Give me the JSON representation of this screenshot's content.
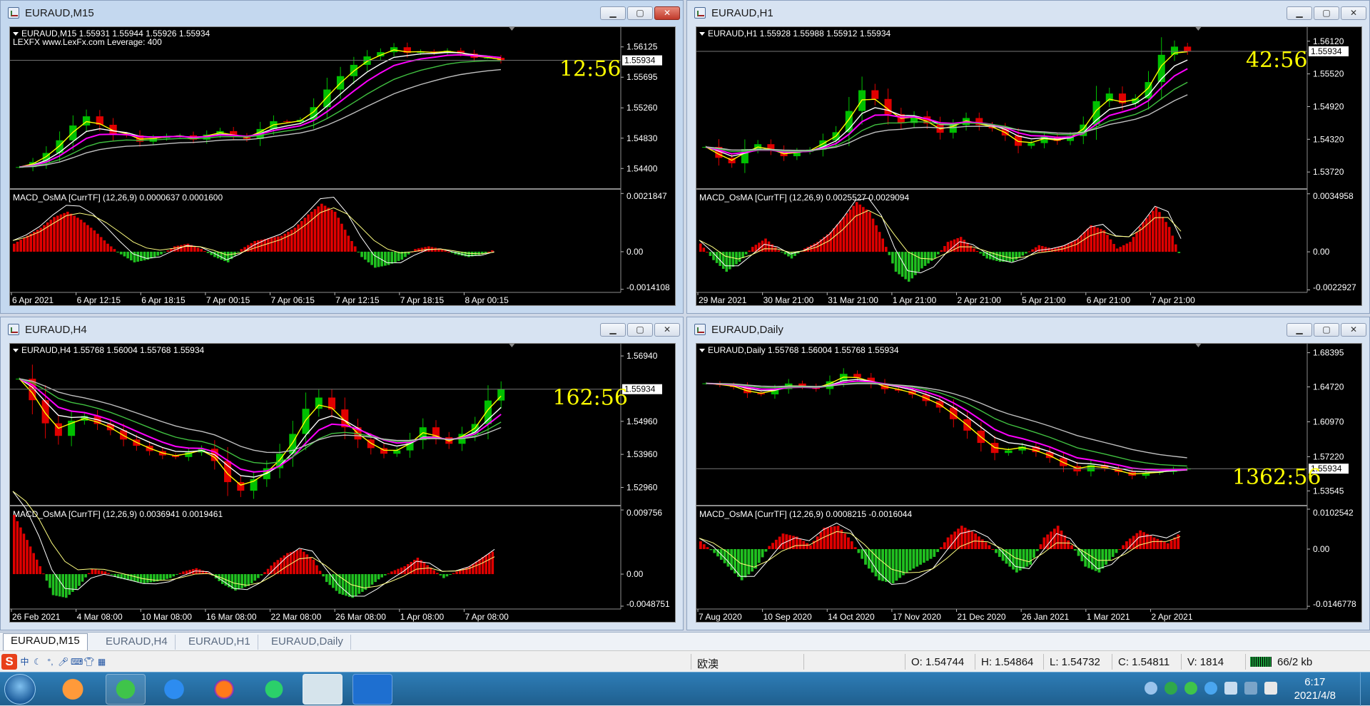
{
  "windows": [
    {
      "title": "EURAUD,M15",
      "active": true,
      "price_info": "EURAUD,M15  1.55931 1.55944 1.55926 1.55934",
      "broker_line": "LEXFX www.LexFx.com Leverage: 400",
      "countdown": "12:56",
      "current_price": "1.55934",
      "price_ticks": [
        "1.56125",
        "1.55695",
        "1.55260",
        "1.54830",
        "1.54400"
      ],
      "macd_label": "MACD_OsMA [CurrTF] (12,26,9) 0.0000637 0.0001600",
      "macd_ticks": [
        "0.0021847",
        "0.00",
        "-0.0014108"
      ],
      "time_labels": [
        "6 Apr 2021",
        "6 Apr 12:15",
        "6 Apr 18:15",
        "7 Apr 00:15",
        "7 Apr 06:15",
        "7 Apr 12:15",
        "7 Apr 18:15",
        "8 Apr 00:15"
      ],
      "price_range": [
        1.5418,
        1.56345
      ],
      "macd_range": [
        -0.0015,
        0.0023
      ],
      "series": {
        "close": [
          1.5442,
          1.5449,
          1.5462,
          1.548,
          1.5501,
          1.5514,
          1.5502,
          1.5489,
          1.5487,
          1.5478,
          1.5483,
          1.5486,
          1.5487,
          1.5481,
          1.5488,
          1.5493,
          1.5486,
          1.5482,
          1.5496,
          1.5507,
          1.5506,
          1.5509,
          1.5527,
          1.5552,
          1.5571,
          1.5587,
          1.5599,
          1.5605,
          1.5612,
          1.5604,
          1.5606,
          1.5604,
          1.5607,
          1.5603,
          1.5597,
          1.5597,
          1.5593
        ],
        "macd": [
          0.0003,
          0.0006,
          0.0009,
          0.0013,
          0.0015,
          0.0012,
          0.0008,
          0.0003,
          -0.0001,
          -0.0004,
          -0.0003,
          -0.0001,
          0.0002,
          0.0003,
          0.0001,
          -0.0002,
          -0.0004,
          0.0001,
          0.0004,
          0.0005,
          0.0006,
          0.0009,
          0.0014,
          0.0018,
          0.0015,
          0.0006,
          -0.0002,
          -0.0006,
          -0.0005,
          -0.0003,
          0.0001,
          0.0002,
          0.0001,
          -0.0001,
          -0.0002,
          -0.0001,
          0.0001
        ]
      }
    },
    {
      "title": "EURAUD,H1",
      "active": false,
      "price_info": "EURAUD,H1  1.55928 1.55988 1.55912 1.55934",
      "broker_line": "",
      "countdown": "42:56",
      "current_price": "1.55934",
      "price_ticks": [
        "1.56120",
        "1.55520",
        "1.54920",
        "1.54320",
        "1.53720"
      ],
      "macd_label": "MACD_OsMA [CurrTF] (12,26,9) 0.0025527 0.0029094",
      "macd_ticks": [
        "0.0034958",
        "0.00",
        "-0.0022927"
      ],
      "time_labels": [
        "29 Mar 2021",
        "30 Mar 21:00",
        "31 Mar 21:00",
        "1 Apr 21:00",
        "2 Apr 21:00",
        "5 Apr 21:00",
        "6 Apr 21:00",
        "7 Apr 21:00"
      ],
      "price_range": [
        1.535,
        1.563
      ],
      "macd_range": [
        -0.0024,
        0.0037
      ],
      "series": {
        "close": [
          1.5418,
          1.5398,
          1.5388,
          1.5414,
          1.5423,
          1.5412,
          1.5401,
          1.5409,
          1.5413,
          1.543,
          1.5445,
          1.5484,
          1.5522,
          1.5506,
          1.5478,
          1.5462,
          1.5474,
          1.5461,
          1.5444,
          1.5458,
          1.5471,
          1.5458,
          1.5452,
          1.5439,
          1.542,
          1.5425,
          1.5437,
          1.5429,
          1.5438,
          1.5459,
          1.5502,
          1.5516,
          1.5498,
          1.5507,
          1.5537,
          1.5587,
          1.5602,
          1.5594
        ],
        "macd": [
          0.0005,
          -0.0005,
          -0.0012,
          -0.0006,
          0.0003,
          0.0008,
          0.0001,
          -0.0004,
          0.0002,
          0.0006,
          0.0012,
          0.0021,
          0.003,
          0.0024,
          0.0008,
          -0.0012,
          -0.0018,
          -0.001,
          -0.0004,
          0.0006,
          0.0009,
          0.0002,
          -0.0004,
          -0.0006,
          -0.0006,
          -0.0001,
          0.0004,
          0.0002,
          0.0004,
          0.0008,
          0.0016,
          0.0013,
          0.0002,
          0.0006,
          0.0018,
          0.0027,
          0.0015,
          -0.0006
        ]
      }
    },
    {
      "title": "EURAUD,H4",
      "active": false,
      "price_info": "EURAUD,H4  1.55768 1.56004 1.55768 1.55934",
      "broker_line": "",
      "countdown": "162:56",
      "current_price": "1.55934",
      "price_ticks": [
        "1.56940",
        "1.55934",
        "1.54960",
        "1.53960",
        "1.52960"
      ],
      "macd_label": "MACD_OsMA [CurrTF] (12,26,9) 0.0036941 0.0019461",
      "macd_ticks": [
        "0.009756",
        "0.00",
        "-0.0048751"
      ],
      "time_labels": [
        "26 Feb 2021",
        "4 Mar 08:00",
        "10 Mar 08:00",
        "16 Mar 08:00",
        "22 Mar 08:00",
        "26 Mar 08:00",
        "1 Apr 08:00",
        "7 Apr 08:00"
      ],
      "price_range": [
        1.5256,
        1.5718
      ],
      "macd_range": [
        -0.0052,
        0.0102
      ],
      "series": {
        "close": [
          1.5625,
          1.556,
          1.549,
          1.5452,
          1.5498,
          1.5512,
          1.5488,
          1.5469,
          1.5441,
          1.5422,
          1.5406,
          1.5393,
          1.5388,
          1.5402,
          1.5413,
          1.5376,
          1.5312,
          1.5286,
          1.5321,
          1.5354,
          1.5398,
          1.5458,
          1.5534,
          1.5568,
          1.5532,
          1.5478,
          1.5441,
          1.5415,
          1.5398,
          1.5408,
          1.5439,
          1.5478,
          1.5448,
          1.5428,
          1.5458,
          1.5488,
          1.5559,
          1.5593
        ],
        "macd": [
          0.009,
          0.0052,
          0.0012,
          -0.0032,
          -0.0036,
          -0.0018,
          0.0008,
          0.0004,
          -0.0006,
          -0.001,
          -0.0014,
          -0.0011,
          -0.0006,
          0.0004,
          0.0009,
          0.0002,
          -0.0015,
          -0.0025,
          -0.0018,
          -0.0002,
          0.0018,
          0.0032,
          0.0038,
          0.0022,
          -0.0012,
          -0.003,
          -0.0036,
          -0.0024,
          -0.0008,
          0.0004,
          0.0012,
          0.0025,
          0.001,
          -0.0006,
          0.0004,
          0.0012,
          0.0026,
          0.0037
        ]
      }
    },
    {
      "title": "EURAUD,Daily",
      "active": false,
      "price_info": "EURAUD,Daily  1.55768 1.56004 1.55768 1.55934",
      "broker_line": "",
      "countdown": "1362:56",
      "current_price": "1.55934",
      "price_ticks": [
        "1.68395",
        "1.64720",
        "1.60970",
        "1.57220",
        "1.53545"
      ],
      "macd_label": "MACD_OsMA [CurrTF] (12,26,9) 0.0008215 -0.0016044",
      "macd_ticks": [
        "0.0102542",
        "0.00",
        "-0.0146778"
      ],
      "time_labels": [
        "7 Aug 2020",
        "10 Sep 2020",
        "14 Oct 2020",
        "17 Nov 2020",
        "21 Dec 2020",
        "26 Jan 2021",
        "1 Mar 2021",
        "2 Apr 2021"
      ],
      "price_range": [
        1.525,
        1.689
      ],
      "macd_range": [
        -0.0152,
        0.0108
      ],
      "series": {
        "close": [
          1.651,
          1.6492,
          1.647,
          1.6405,
          1.6392,
          1.6448,
          1.6508,
          1.6478,
          1.645,
          1.6532,
          1.6612,
          1.6571,
          1.6508,
          1.6448,
          1.6432,
          1.6389,
          1.632,
          1.625,
          1.6125,
          1.6002,
          1.587,
          1.5762,
          1.5789,
          1.5832,
          1.5771,
          1.5708,
          1.5621,
          1.5564,
          1.5632,
          1.5598,
          1.5558,
          1.5517,
          1.5548,
          1.556,
          1.5586,
          1.5593
        ],
        "macd": [
          0.002,
          -0.001,
          -0.0045,
          -0.008,
          -0.005,
          0.0008,
          0.004,
          0.0032,
          0.001,
          0.0055,
          0.006,
          0.002,
          -0.004,
          -0.008,
          -0.0088,
          -0.006,
          -0.004,
          -0.002,
          0.003,
          0.006,
          0.004,
          0.001,
          -0.003,
          -0.006,
          -0.004,
          0.003,
          0.006,
          0.001,
          -0.0045,
          -0.006,
          -0.002,
          0.002,
          0.0048,
          0.003,
          0.0015,
          0.0045
        ]
      }
    }
  ],
  "tabs": [
    "EURAUD,M15",
    "EURAUD,H4",
    "EURAUD,H1",
    "EURAUD,Daily"
  ],
  "status": {
    "symbol_name": "欧澳",
    "open": "O: 1.54744",
    "high": "H: 1.54864",
    "low": "L: 1.54732",
    "close": "C: 1.54811",
    "volume": "V: 1814",
    "traffic": "66/2 kb"
  },
  "ime_toolbar": {
    "logo": "S",
    "mode": "中"
  },
  "clock": {
    "time": "6:17",
    "date": "2021/4/8"
  },
  "colors": {
    "chart_bg": "#000000",
    "bull": "#00c000",
    "bear": "#e00000",
    "ma_fast": "#ffff00",
    "ma_mid": "#ff00ff",
    "ma_slow": "#40c040",
    "ma_long": "#c0c0c0",
    "countdown": "#ffff00",
    "hist_pos": "#e00000",
    "hist_neg": "#20c020"
  },
  "taskbar_icons": [
    "start-orb",
    "media-player-app",
    "wechat-app",
    "edit-app",
    "firefox-browser",
    "video-player-app",
    "metatrader-app",
    "security-app"
  ]
}
